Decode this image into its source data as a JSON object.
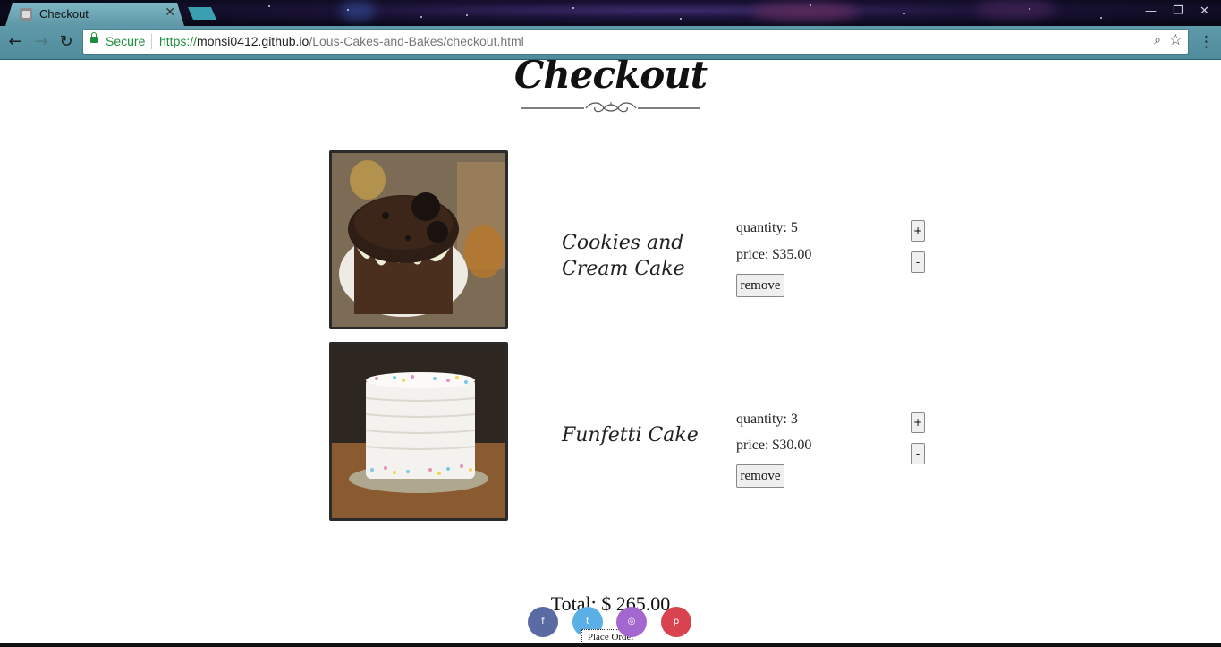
{
  "browser": {
    "tab_title": "Checkout",
    "tab_close": "✕",
    "back_glyph": "←",
    "forward_glyph": "→",
    "reload_glyph": "↻",
    "secure_label": "Secure",
    "url_scheme": "https://",
    "url_host": "monsi0412.github.io",
    "url_path": "/Lous-Cakes-and-Bakes/checkout.html",
    "zoom_glyph": "⌕",
    "bookmark_glyph": "☆",
    "menu_glyph": "⋮",
    "minimize_glyph": "—",
    "restore_glyph": "❐",
    "close_glyph": "✕"
  },
  "page": {
    "heading": "Checkout",
    "items": [
      {
        "name": "Cookies and Cream Cake",
        "quantity": "quantity: 5",
        "price": "price: $35.00",
        "plus_label": "+",
        "minus_label": "-",
        "remove_label": "remove"
      },
      {
        "name": "Funfetti Cake",
        "quantity": "quantity: 3",
        "price": "price: $30.00",
        "plus_label": "+",
        "minus_label": "-",
        "remove_label": "remove"
      }
    ],
    "total": "Total: $ 265.00",
    "place_order": "Place Order",
    "social": [
      {
        "icon": "facebook-icon",
        "glyph": "f",
        "color": "#5a6ba3"
      },
      {
        "icon": "twitter-icon",
        "glyph": "t",
        "color": "#5ab0e6"
      },
      {
        "icon": "instagram-icon",
        "glyph": "◎",
        "color": "#a466cf"
      },
      {
        "icon": "pinterest-icon",
        "glyph": "p",
        "color": "#d9424f"
      }
    ]
  }
}
